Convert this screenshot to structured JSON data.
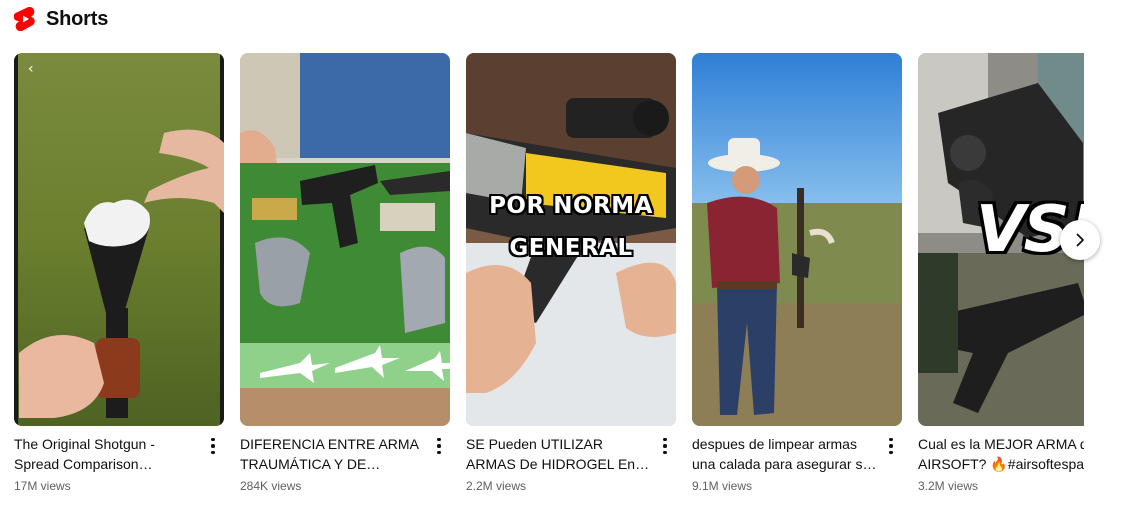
{
  "section": {
    "title": "Shorts",
    "logo_icon": "youtube-shorts-icon",
    "logo_color": "#ff0000"
  },
  "shorts": [
    {
      "title": "The Original Shotgun - Spread Comparison #shorts…",
      "views": "17M views"
    },
    {
      "title": "DIFERENCIA ENTRE ARMA TRAUMÁTICA Y DE FOGUEO",
      "views": "284K views"
    },
    {
      "title": "SE Pueden UTILIZAR ARMAS De HIDROGEL En Airsoft?…",
      "views": "2.2M views",
      "overlay_line1": "POR NORMA",
      "overlay_line2": "GENERAL"
    },
    {
      "title": "despues de limpear armas una calada para asegurar s…",
      "views": "9.1M views"
    },
    {
      "title": "Cual es la MEJOR ARMA d AIRSOFT? 🔥#airsoftespa",
      "views": "3.2M views",
      "overlay_text": "VS!"
    }
  ],
  "icons": {
    "more": "vertical-ellipsis-icon",
    "next": "chevron-right-icon"
  }
}
